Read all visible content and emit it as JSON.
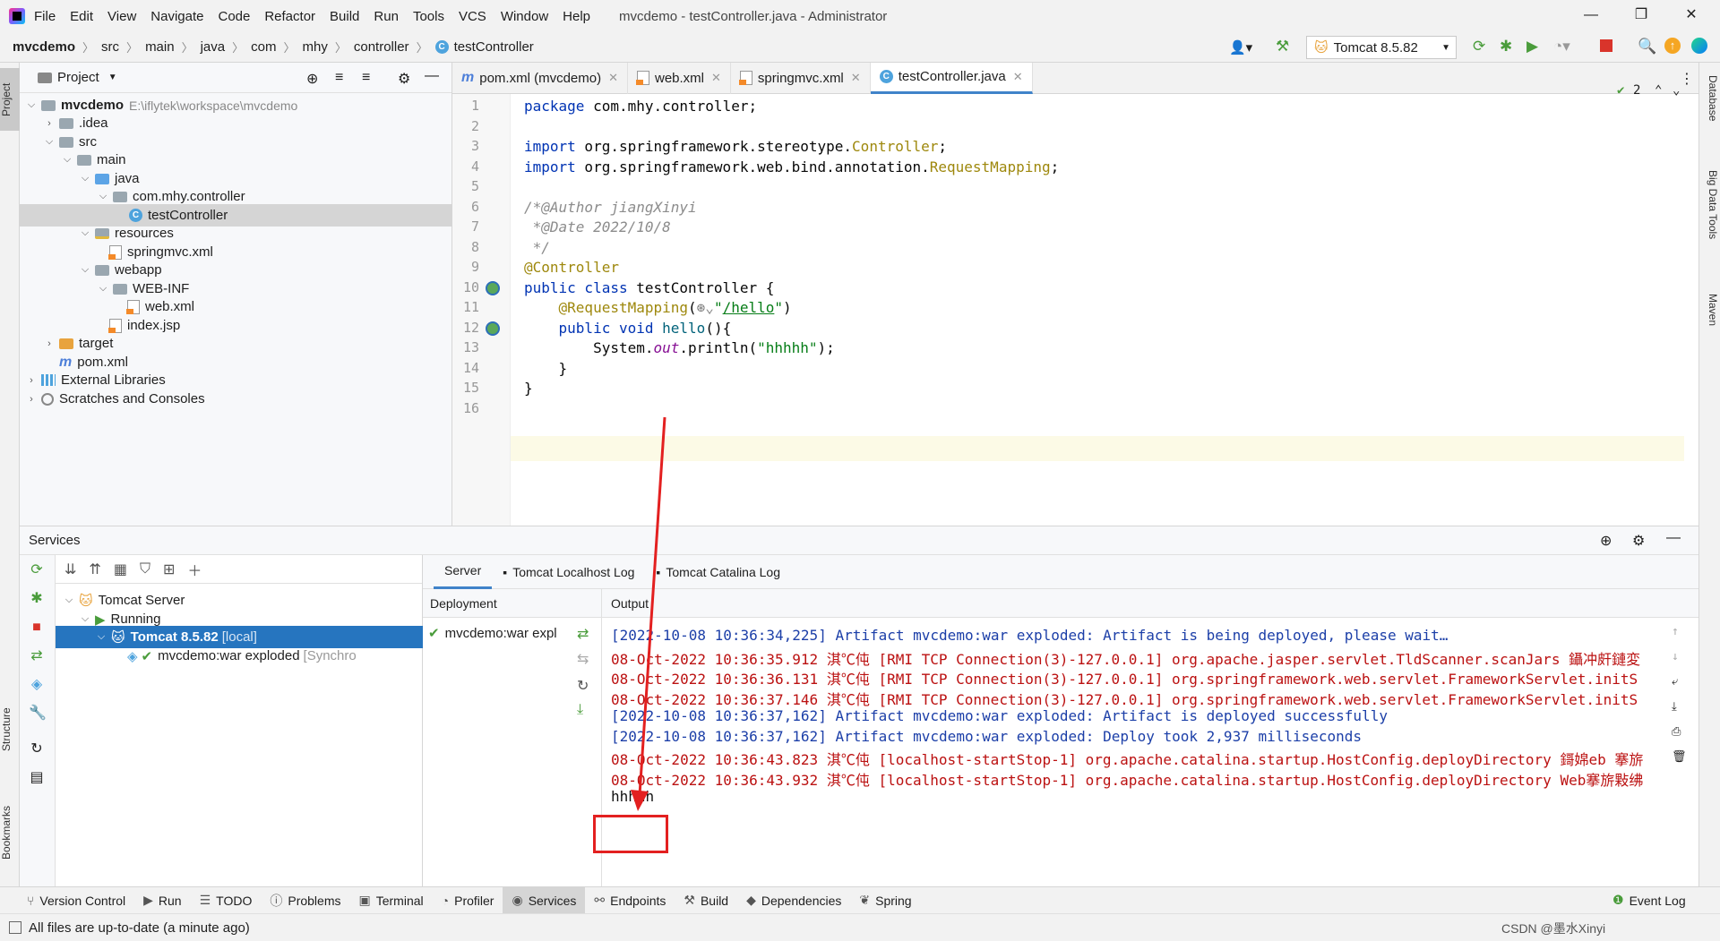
{
  "window": {
    "title": "mvcdemo - testController.java - Administrator",
    "menu": [
      "File",
      "Edit",
      "View",
      "Navigate",
      "Code",
      "Refactor",
      "Build",
      "Run",
      "Tools",
      "VCS",
      "Window",
      "Help"
    ]
  },
  "breadcrumb": [
    "mvcdemo",
    "src",
    "main",
    "java",
    "com",
    "mhy",
    "controller",
    "testController"
  ],
  "run_config": "Tomcat 8.5.82",
  "left_strip": [
    "Project",
    "Structure",
    "Bookmarks"
  ],
  "right_strip": [
    "Database",
    "Big Data Tools",
    "Maven"
  ],
  "project": {
    "header": "Project",
    "tree": [
      {
        "label": "mvcdemo",
        "extra": "E:\\iflytek\\workspace\\mvcdemo"
      },
      {
        "label": ".idea"
      },
      {
        "label": "src"
      },
      {
        "label": "main"
      },
      {
        "label": "java"
      },
      {
        "label": "com.mhy.controller"
      },
      {
        "label": "testController"
      },
      {
        "label": "resources"
      },
      {
        "label": "springmvc.xml"
      },
      {
        "label": "webapp"
      },
      {
        "label": "WEB-INF"
      },
      {
        "label": "web.xml"
      },
      {
        "label": "index.jsp"
      },
      {
        "label": "target"
      },
      {
        "label": "pom.xml"
      },
      {
        "label": "External Libraries"
      },
      {
        "label": "Scratches and Consoles"
      }
    ]
  },
  "editor": {
    "tabs": [
      "pom.xml (mvcdemo)",
      "web.xml",
      "springmvc.xml",
      "testController.java"
    ],
    "inspection_count": "2",
    "line_numbers": [
      "1",
      "2",
      "3",
      "4",
      "5",
      "6",
      "7",
      "8",
      "9",
      "10",
      "11",
      "12",
      "13",
      "14",
      "15",
      "16"
    ]
  },
  "services": {
    "title": "Services",
    "tree": [
      {
        "label": "Tomcat Server"
      },
      {
        "label": "Running"
      },
      {
        "label": "Tomcat 8.5.82",
        "tag": "[local]"
      },
      {
        "label": "mvcdemo:war exploded",
        "tag": "[Synchro"
      }
    ],
    "tabs": [
      "Server",
      "Tomcat Localhost Log",
      "Tomcat Catalina Log"
    ],
    "deployment_header": "Deployment",
    "deployment_item": "mvcdemo:war expl",
    "output_header": "Output",
    "output_lines": [
      "[2022-10-08 10:36:34,225] Artifact mvcdemo:war exploded: Artifact is being deployed, please wait…",
      "08-Oct-2022 10:36:35.912 淇℃伅 [RMI TCP Connection(3)-127.0.0.1] org.apache.jasper.servlet.TldScanner.scanJars 鑷冲皯鏈変",
      "08-Oct-2022 10:36:36.131 淇℃伅 [RMI TCP Connection(3)-127.0.0.1] org.springframework.web.servlet.FrameworkServlet.initS",
      "08-Oct-2022 10:36:37.146 淇℃伅 [RMI TCP Connection(3)-127.0.0.1] org.springframework.web.servlet.FrameworkServlet.initS",
      "[2022-10-08 10:36:37,162] Artifact mvcdemo:war exploded: Artifact is deployed successfully",
      "[2022-10-08 10:36:37,162] Artifact mvcdemo:war exploded: Deploy took 2,937 milliseconds",
      "08-Oct-2022 10:36:43.823 淇℃伅 [localhost-startStop-1] org.apache.catalina.startup.HostConfig.deployDirectory 鎶婂eb 搴旂",
      "08-Oct-2022 10:36:43.932 淇℃伅 [localhost-startStop-1] org.apache.catalina.startup.HostConfig.deployDirectory Web搴旂敤绋",
      "hhhhh"
    ]
  },
  "bottom_tabs": [
    "Version Control",
    "Run",
    "TODO",
    "Problems",
    "Terminal",
    "Profiler",
    "Services",
    "Endpoints",
    "Build",
    "Dependencies",
    "Spring"
  ],
  "event_log": "Event Log",
  "status": "All files are up-to-date (a minute ago)",
  "watermark": "CSDN @墨水Xinyi"
}
